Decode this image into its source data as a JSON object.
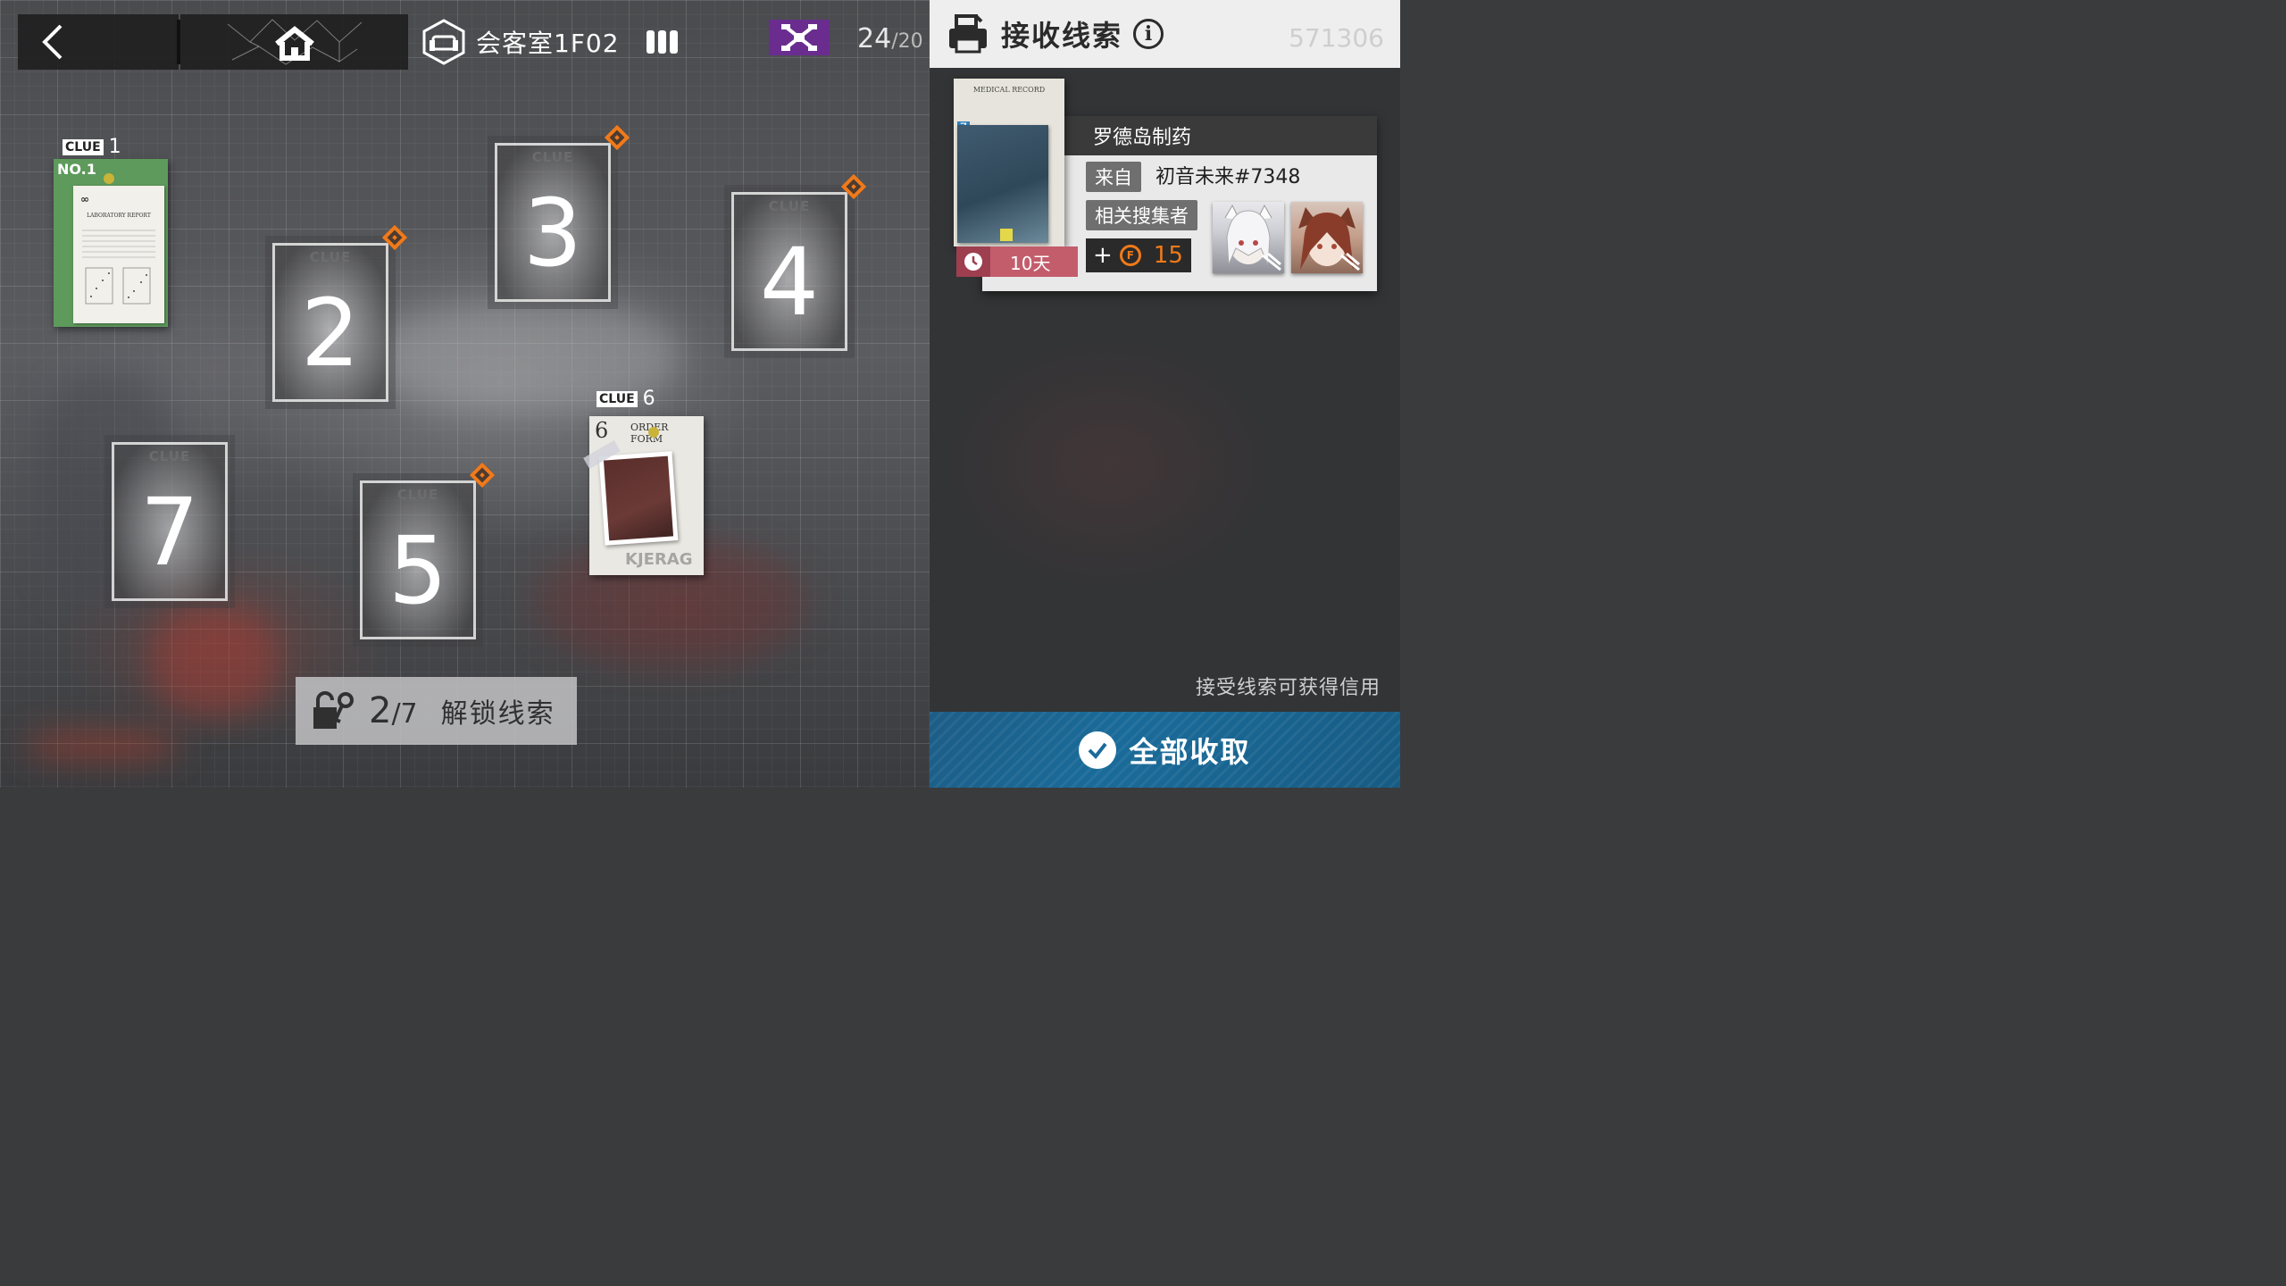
{
  "topbar": {
    "room_title": "会客室1F02",
    "drone_count": "24",
    "drone_max": "/20"
  },
  "slots": [
    {
      "num": "2",
      "label": "CLUE"
    },
    {
      "num": "3",
      "label": "CLUE"
    },
    {
      "num": "4",
      "label": "CLUE"
    },
    {
      "num": "7",
      "label": "CLUE"
    },
    {
      "num": "5",
      "label": "CLUE"
    }
  ],
  "placed_clues": [
    {
      "tag": "CLUE",
      "num": "1",
      "doc_no": "NO.1",
      "doc_title": "LABORATORY REPORT"
    },
    {
      "tag": "CLUE",
      "num": "6",
      "doc_no": "6",
      "doc_title": "ORDER FORM",
      "doc_mark": "KJERAG"
    }
  ],
  "unlock": {
    "count": "2",
    "total": "/7",
    "label": "解锁线索"
  },
  "panel": {
    "header_title": "接收线索",
    "header_ghost": "571306",
    "card": {
      "doc_header": "MEDICAL RECORD",
      "clue_num": "7",
      "title": "罗德岛制药",
      "from_label": "来自",
      "from_name": "初音未来#7348",
      "collectors_label": "相关搜集者",
      "time_left": "10天",
      "credit_plus": "+",
      "credit_amount": "15"
    },
    "hint": "接受线索可获得信用",
    "collect_all": "全部收取"
  },
  "colors": {
    "accent_orange": "#f07a1a",
    "drone_purple": "#6a2d8f",
    "time_badge": "#c35d6c",
    "collect_blue": "#1a6b9a"
  }
}
